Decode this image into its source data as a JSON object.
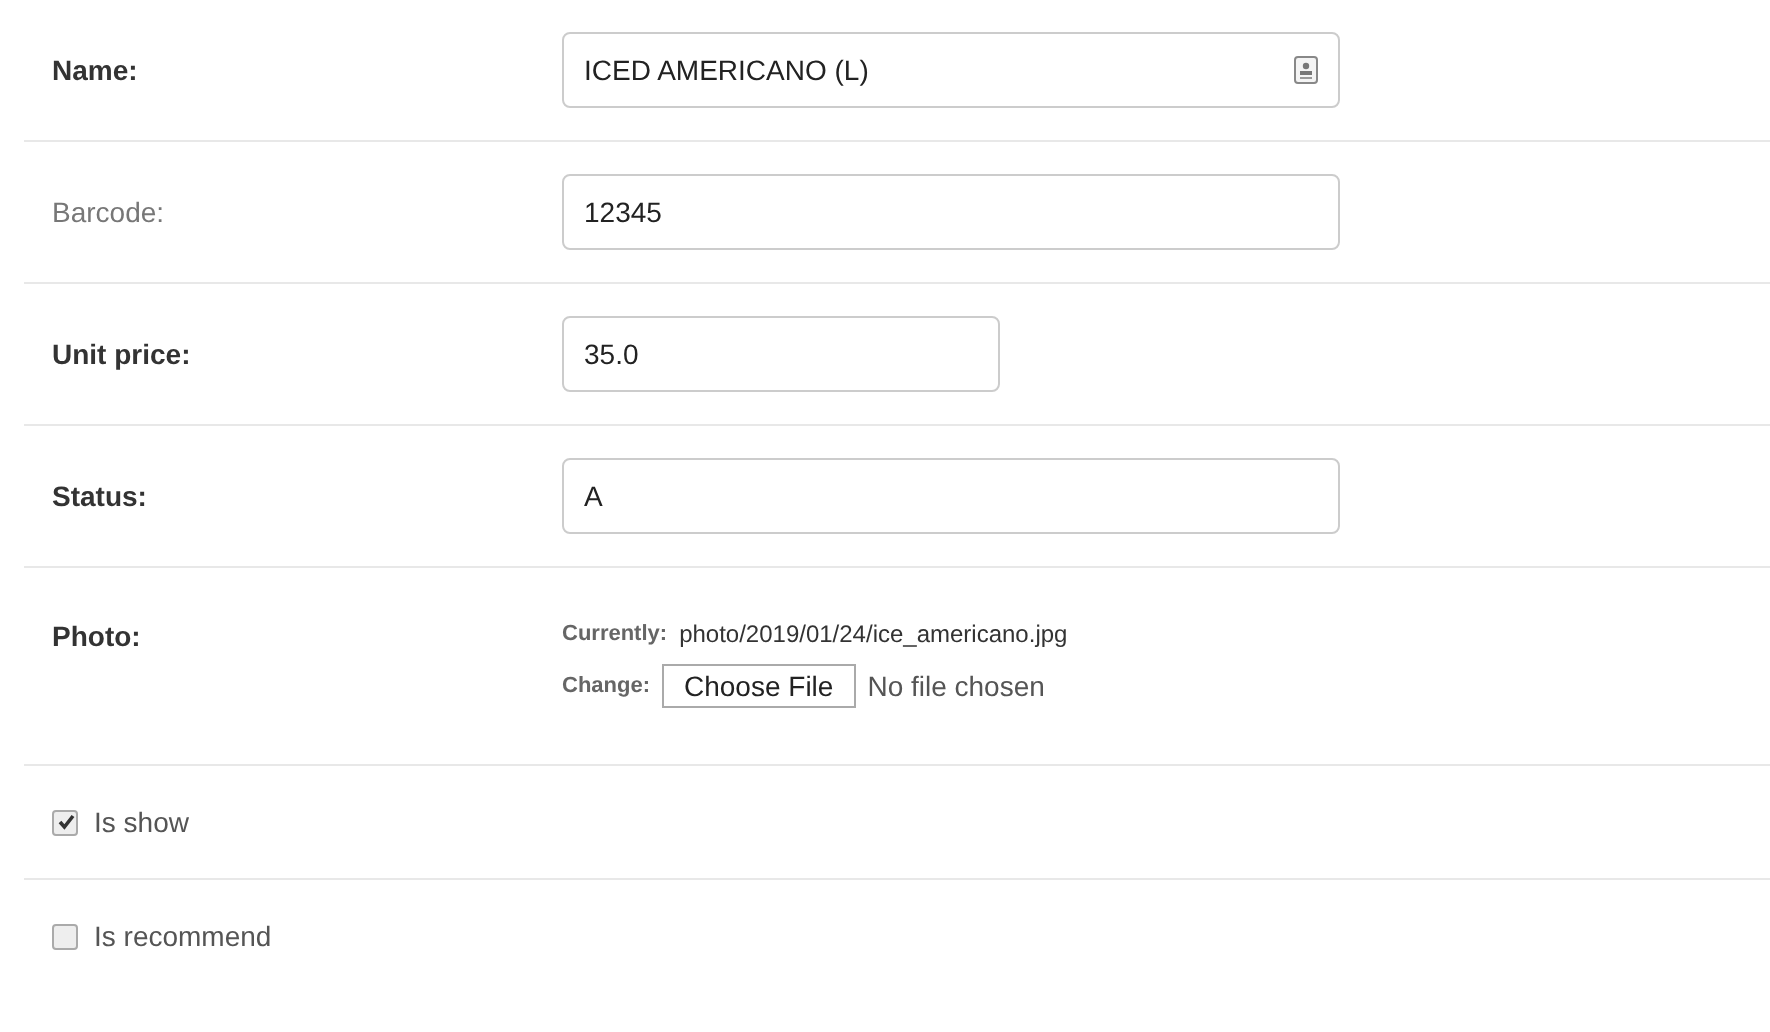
{
  "fields": [
    {
      "kind": "text",
      "label": "Name:",
      "required": true,
      "value": "ICED AMERICANO (L)",
      "autofill_icon": true
    },
    {
      "kind": "text",
      "label": "Barcode:",
      "required": false,
      "value": "12345",
      "autofill_icon": false
    },
    {
      "kind": "number",
      "label": "Unit price:",
      "required": true,
      "value": "35.0",
      "autofill_icon": false
    },
    {
      "kind": "text",
      "label": "Status:",
      "required": true,
      "value": "A",
      "autofill_icon": false
    }
  ],
  "photo": {
    "label": "Photo:",
    "currently_label": "Currently:",
    "current_file": "photo/2019/01/24/ice_americano.jpg",
    "change_label": "Change:",
    "button": "Choose File",
    "file_status": "No file chosen"
  },
  "checkboxes": [
    {
      "label": "Is show",
      "checked": true
    },
    {
      "label": "Is recommend",
      "checked": false
    }
  ]
}
